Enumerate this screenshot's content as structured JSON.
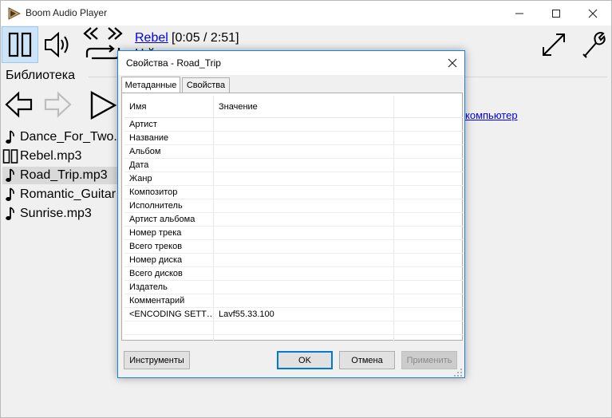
{
  "app": {
    "title": "Boom Audio Player"
  },
  "player": {
    "track_link": "Rebel",
    "time": "[0:05 / 2:51]",
    "subtitle": "Н         й"
  },
  "library": {
    "title": "Библиотека",
    "computer_link": "компьютер",
    "files": [
      {
        "name": "Dance_For_Two.",
        "icon": "music-note-icon",
        "selected": false
      },
      {
        "name": "Rebel.mp3",
        "icon": "pause-icon",
        "selected": false
      },
      {
        "name": "Road_Trip.mp3",
        "icon": "music-note-icon",
        "selected": true
      },
      {
        "name": "Romantic_Guitar",
        "icon": "music-note-icon",
        "selected": false
      },
      {
        "name": "Sunrise.mp3",
        "icon": "music-note-icon",
        "selected": false
      }
    ]
  },
  "dialog": {
    "title": "Свойства - Road_Trip",
    "tabs": [
      {
        "label": "Метаданные",
        "active": true
      },
      {
        "label": "Свойства",
        "active": false
      }
    ],
    "grid": {
      "col_name": "Имя",
      "col_value": "Значение",
      "rows": [
        {
          "name": "Артист",
          "value": ""
        },
        {
          "name": "Название",
          "value": ""
        },
        {
          "name": "Альбом",
          "value": ""
        },
        {
          "name": "Дата",
          "value": ""
        },
        {
          "name": "Жанр",
          "value": ""
        },
        {
          "name": "Композитор",
          "value": ""
        },
        {
          "name": "Исполнитель",
          "value": ""
        },
        {
          "name": "Артист альбома",
          "value": ""
        },
        {
          "name": "Номер трека",
          "value": ""
        },
        {
          "name": "Всего треков",
          "value": ""
        },
        {
          "name": "Номер диска",
          "value": ""
        },
        {
          "name": "Всего дисков",
          "value": ""
        },
        {
          "name": "Издатель",
          "value": ""
        },
        {
          "name": "Комментарий",
          "value": ""
        },
        {
          "name": "<ENCODING SETT…",
          "value": "Lavf55.33.100"
        },
        {
          "name": "",
          "value": ""
        }
      ]
    },
    "buttons": {
      "tools": "Инструменты",
      "ok": "OK",
      "cancel": "Отмена",
      "apply": "Применить"
    }
  },
  "colors": {
    "accent": "#0078d7",
    "dialog_border": "#1883d7",
    "link": "#0000ee",
    "selection": "#d9d9d9",
    "pause_highlight": "#cce4f7"
  }
}
